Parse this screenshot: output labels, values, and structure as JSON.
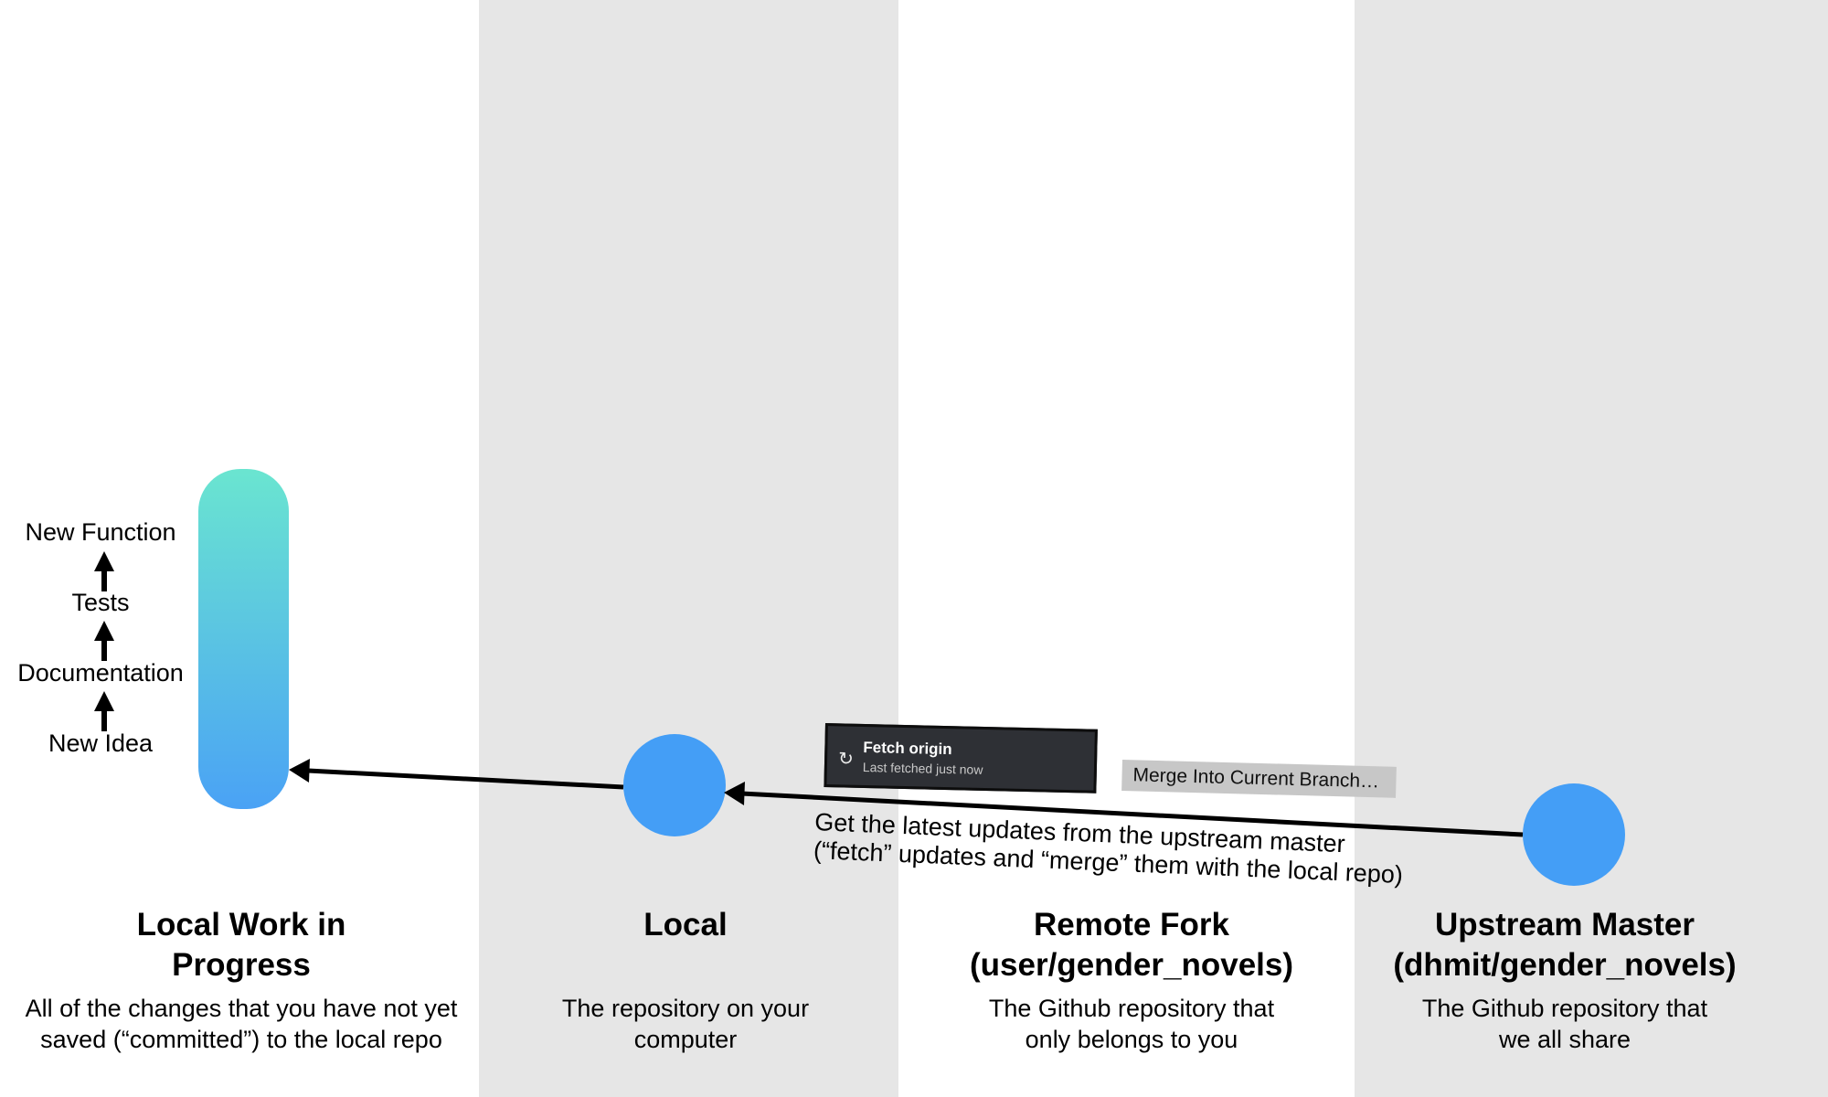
{
  "colors": {
    "band": "#e6e6e6",
    "node": "#449ef6",
    "pill_top": "#6ae5d0",
    "pill_bottom": "#4aa2f5",
    "fetch_bg": "#2e3035",
    "merge_bg": "#c7c7c7",
    "arrow": "#000000"
  },
  "workflow_steps": [
    "New Function",
    "Tests",
    "Documentation",
    "New Idea"
  ],
  "fetch_button": {
    "icon": "refresh-icon",
    "title": "Fetch origin",
    "subtitle": "Last fetched just now"
  },
  "merge_button": {
    "label": "Merge Into Current Branch…"
  },
  "caption": {
    "line1": "Get the latest updates from the upstream master",
    "line2": "(“fetch” updates and “merge” them with the local repo)"
  },
  "columns": [
    {
      "title_lines": [
        "Local Work in",
        "Progress"
      ],
      "desc_lines": [
        "All of the changes that you have not yet",
        "saved (“committed”) to the local repo"
      ]
    },
    {
      "title_lines": [
        "Local"
      ],
      "desc_lines": [
        "The repository on your",
        "computer"
      ]
    },
    {
      "title_lines": [
        "Remote Fork",
        "(user/gender_novels)"
      ],
      "desc_lines": [
        "The Github repository that",
        "only belongs to you"
      ]
    },
    {
      "title_lines": [
        "Upstream Master",
        "(dhmit/gender_novels)"
      ],
      "desc_lines": [
        "The Github repository that",
        "we all share"
      ]
    }
  ]
}
